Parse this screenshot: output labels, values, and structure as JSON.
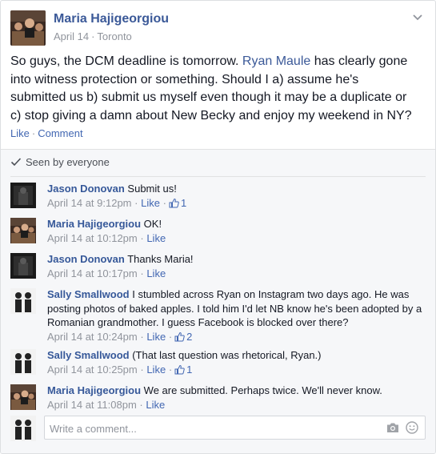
{
  "post": {
    "author": "Maria Hajigeorgiou",
    "date": "April 14",
    "separator": "·",
    "location": "Toronto",
    "text_before": "So guys, the DCM deadline is tomorrow. ",
    "mention": "Ryan Maule",
    "text_after": " has clearly gone into witness protection or something. Should I a) assume he's submitted us b) submit us myself even though it may be a duplicate or c) stop giving a damn about New Becky and enjoy my weekend in NY?",
    "actions": {
      "like": "Like",
      "dot": "·",
      "comment": "Comment"
    }
  },
  "seen_by": "Seen by everyone",
  "comments": [
    {
      "author": "Jason Donovan",
      "text": "Submit us!",
      "time": "April 14 at 9:12pm",
      "dot": "·",
      "like": "Like",
      "dot2": "·",
      "likes": "1"
    },
    {
      "author": "Maria Hajigeorgiou",
      "text": "OK!",
      "time": "April 14 at 10:12pm",
      "dot": "·",
      "like": "Like"
    },
    {
      "author": "Jason Donovan",
      "text": "Thanks Maria!",
      "time": "April 14 at 10:17pm",
      "dot": "·",
      "like": "Like"
    },
    {
      "author": "Sally Smallwood",
      "text": "I stumbled across Ryan on Instagram two days ago. He was posting photos of baked apples. I told him I'd let NB know he's been adopted by a Romanian grandmother. I guess Facebook is blocked over there?",
      "time": "April 14 at 10:24pm",
      "dot": "·",
      "like": "Like",
      "dot2": "·",
      "likes": "2"
    },
    {
      "author": "Sally Smallwood",
      "text": "(That last question was rhetorical, Ryan.)",
      "time": "April 14 at 10:25pm",
      "dot": "·",
      "like": "Like",
      "dot2": "·",
      "likes": "1"
    },
    {
      "author": "Maria Hajigeorgiou",
      "text": "We are submitted. Perhaps twice. We'll never know.",
      "time": "April 14 at 11:08pm",
      "dot": "·",
      "like": "Like"
    }
  ],
  "composer": {
    "placeholder": "Write a comment..."
  },
  "icons": {
    "chevron": "chevron-down-icon",
    "check": "checkmark-icon",
    "thumb": "thumbs-up-icon",
    "camera": "camera-icon",
    "emoji": "emoji-icon"
  },
  "colors": {
    "link": "#3b5998",
    "meta": "#90949c",
    "action": "#4267b2",
    "feedback_bg": "#f6f7f9"
  }
}
